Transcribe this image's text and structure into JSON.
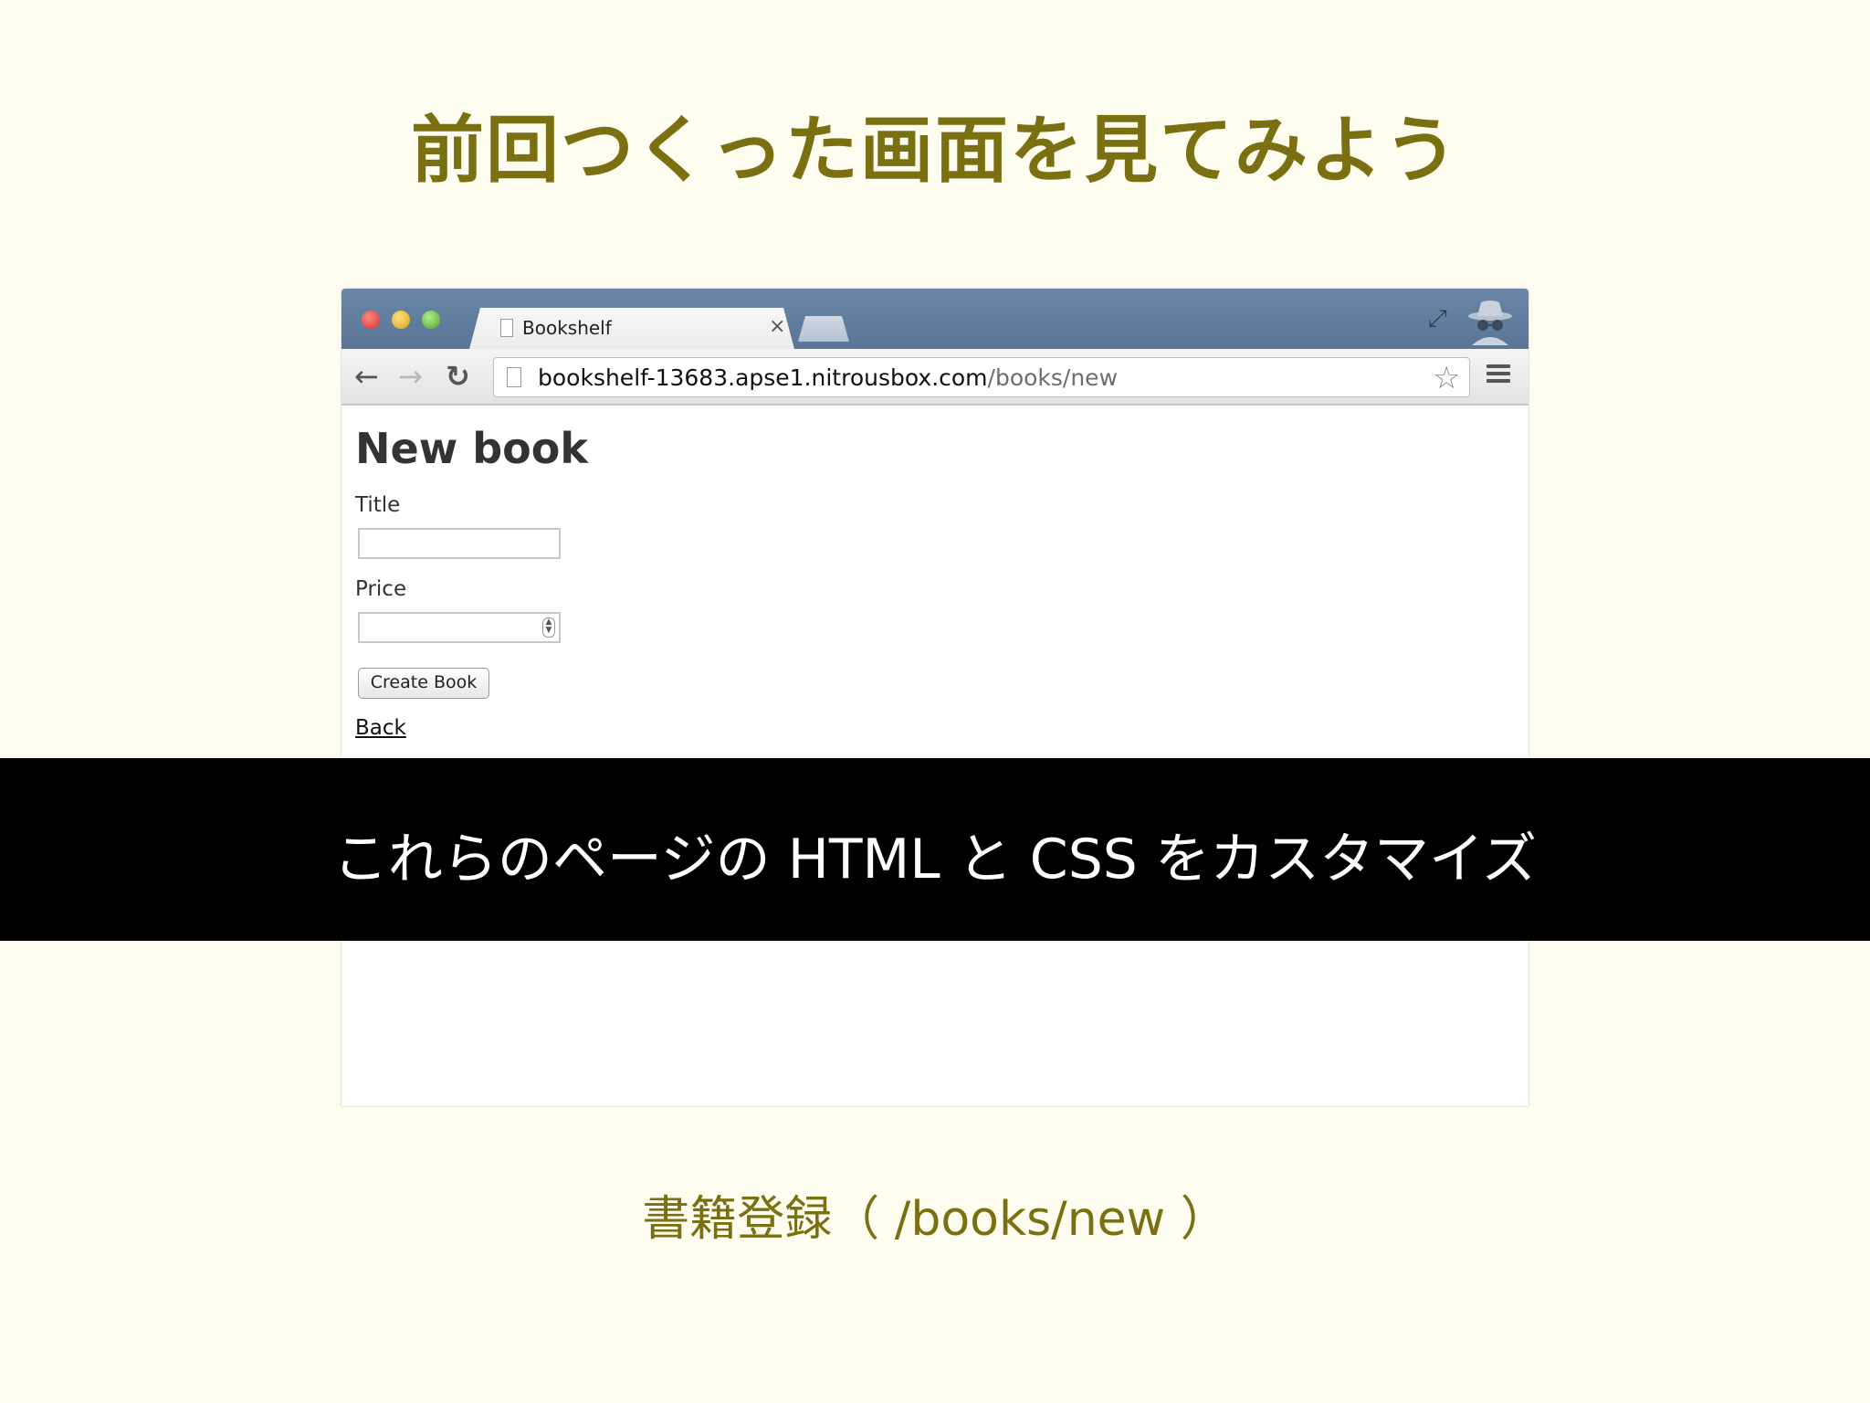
{
  "slide": {
    "title": "前回つくった画面を見てみよう",
    "caption": "これらのページの HTML と CSS をカスタマイズ",
    "bottom_caption": "書籍登録（ /books/new ）"
  },
  "browser": {
    "tab": {
      "title": "Bookshelf",
      "close": "×"
    },
    "toolbar": {
      "back": "←",
      "forward": "→",
      "reload": "↻",
      "url_host": "bookshelf-13683.apse1.nitrousbox.com",
      "url_path": "/books/new",
      "star": "☆"
    },
    "fullscreen": "⤢",
    "icons": [
      "page-icon",
      "star-icon",
      "menu-icon",
      "incognito-icon",
      "fullscreen-icon"
    ]
  },
  "page": {
    "heading": "New book",
    "title_label": "Title",
    "price_label": "Price",
    "submit_label": "Create Book",
    "back_link": "Back"
  },
  "colors": {
    "slide_background": "#fffdf0",
    "title_color": "#7a7012",
    "browser_frame": "#6a87a8",
    "caption_bar": "#000000"
  }
}
